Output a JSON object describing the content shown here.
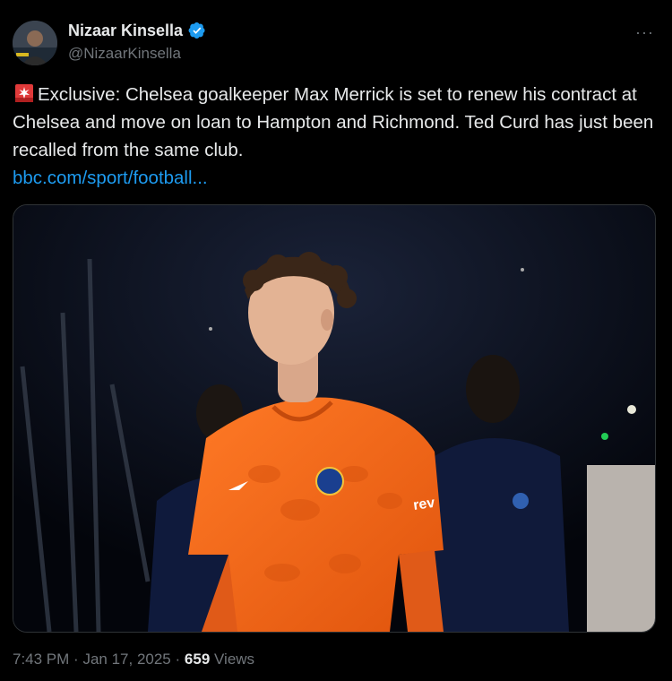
{
  "author": {
    "display_name": "Nizaar Kinsella",
    "handle": "@NizaarKinsella",
    "verified": true,
    "avatar_icon": "profile-photo",
    "verified_icon": "verified-badge-icon"
  },
  "more_button": {
    "label": "···",
    "icon": "more-horizontal-icon"
  },
  "tweet": {
    "emoji_icon": "police-siren-emoji-icon",
    "text": "Exclusive: Chelsea goalkeeper Max Merrick is set to renew his contract at Chelsea and move on loan to Hampton and Richmond. Ted Curd has just been recalled from the same club.",
    "link_text": "bbc.com/sport/football..."
  },
  "media": {
    "type": "photo",
    "badge_text": "rev"
  },
  "meta": {
    "time": "7:43 PM",
    "separator": "·",
    "date": "Jan 17, 2025",
    "views_count": "659",
    "views_label": "Views"
  },
  "colors": {
    "background": "#000000",
    "text": "#e7e9ea",
    "secondary": "#71767b",
    "link": "#1d9bf0",
    "kit_orange": "#f26a1b"
  }
}
